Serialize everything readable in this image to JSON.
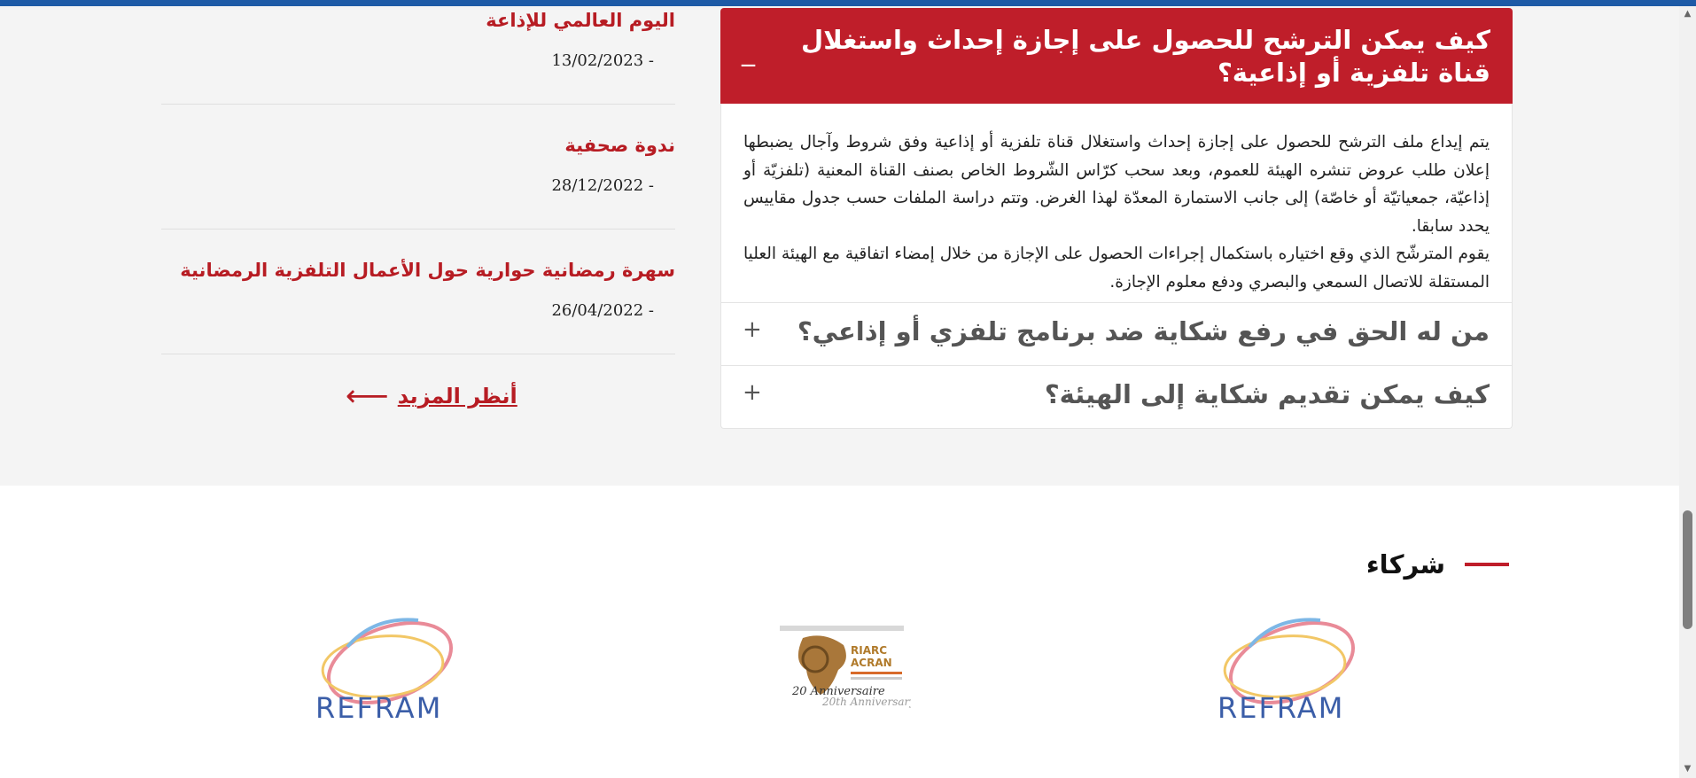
{
  "news": [
    {
      "title": "اليوم العالمي للإذاعة",
      "date": "13/02/2023 -"
    },
    {
      "title": "ندوة صحفية",
      "date": "28/12/2022 -"
    },
    {
      "title": "سهرة رمضانية حوارية حول الأعمال التلفزية الرمضانية",
      "date": "26/04/2022 -"
    }
  ],
  "more_link": {
    "label": "أنظر المزيد",
    "arrow_icon": "long-arrow-left-icon"
  },
  "faq": [
    {
      "question": "كيف يمكن الترشح للحصول على إجازة إحداث واستغلال قناة تلفزية أو إذاعية؟",
      "expanded": true,
      "sign": "_",
      "answer_paragraphs": [
        "يتم إيداع ملف الترشح للحصول على إجازة إحداث واستغلال قناة تلفزية أو إذاعية وفق شروط وآجال يضبطها إعلان طلب عروض تنشره الهيئة للعموم، وبعد سحب كرّاس الشّروط الخاص بصنف القناة المعنية (تلفزيّة أو إذاعيّة، جمعياتيّة أو خاصّة) إلى جانب الاستمارة المعدّة لهذا الغرض. وتتم دراسة الملفات حسب جدول مقاييس يحدد سابقا.",
        "يقوم المترشّح الذي وقع اختياره باستكمال إجراءات الحصول على الإجازة من خلال إمضاء اتفاقية مع الهيئة العليا المستقلة للاتصال السمعي والبصري ودفع معلوم الإجازة."
      ]
    },
    {
      "question": "من له الحق في رفع شكاية ضد برنامج تلفزي أو إذاعي؟",
      "expanded": false,
      "sign": "+"
    },
    {
      "question": "كيف يمكن تقديم شكاية إلى الهيئة؟",
      "expanded": false,
      "sign": "+"
    }
  ],
  "partners": {
    "heading": "شركاء",
    "logos": [
      {
        "name": "REFRAM",
        "text": "REFRAM"
      },
      {
        "name": "RIARC ACRAN",
        "text_main": "RIARC",
        "text_sub": "ACRAN",
        "anniversary": "20 Anniversaire",
        "anniversary_en": "20th Anniversary"
      },
      {
        "name": "REFRAM",
        "text": "REFRAM"
      }
    ]
  },
  "colors": {
    "accent": "#bf1e2a",
    "top_bar": "#1d5aa6",
    "link": "#b71c23"
  }
}
